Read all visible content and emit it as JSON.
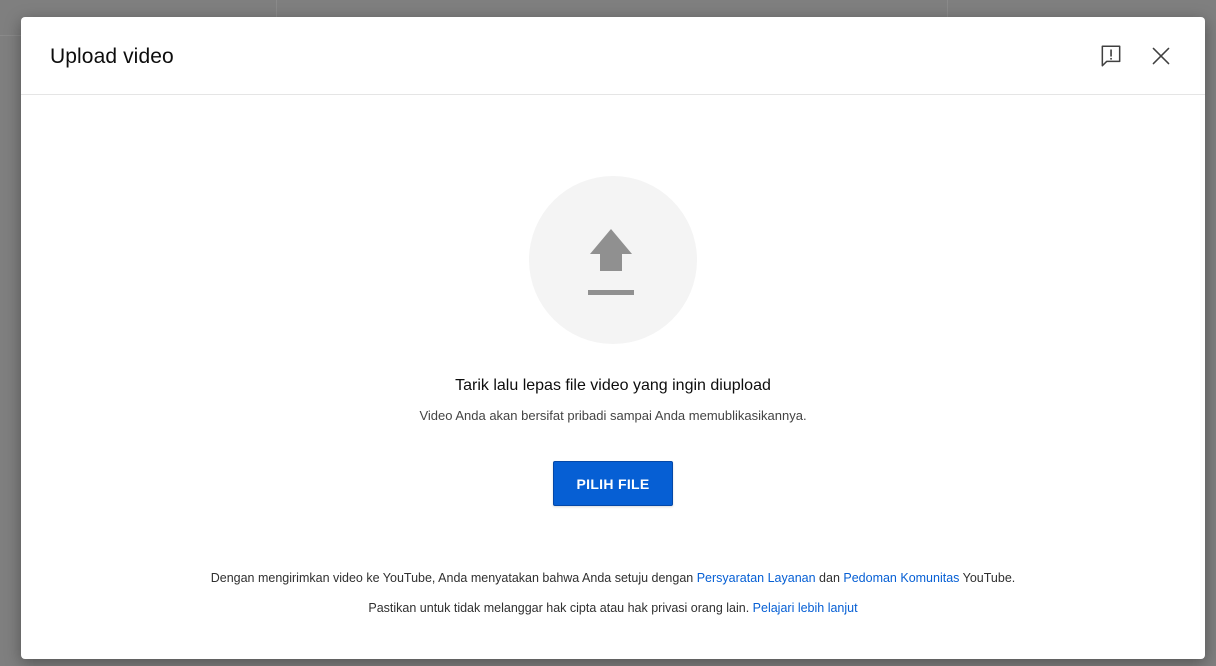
{
  "dialog": {
    "title": "Upload video"
  },
  "upload": {
    "title": "Tarik lalu lepas file video yang ingin diupload",
    "subtitle": "Video Anda akan bersifat pribadi sampai Anda memublikasikannya.",
    "button_label": "PILIH FILE"
  },
  "footer": {
    "line1_prefix": "Dengan mengirimkan video ke YouTube, Anda menyatakan bahwa Anda setuju dengan ",
    "terms_link": "Persyaratan Layanan",
    "line1_middle": " dan ",
    "guidelines_link": "Pedoman Komunitas",
    "line1_suffix": " YouTube.",
    "line2_prefix": "Pastikan untuk tidak melanggar hak cipta atau hak privasi orang lain. ",
    "learn_more_link": "Pelajari lebih lanjut"
  },
  "colors": {
    "accent": "#065fd4",
    "backdrop": "#7f7f7f",
    "icon_gray": "#909090"
  },
  "icons": {
    "feedback": "feedback-icon",
    "close": "close-icon",
    "upload": "upload-arrow-icon"
  }
}
